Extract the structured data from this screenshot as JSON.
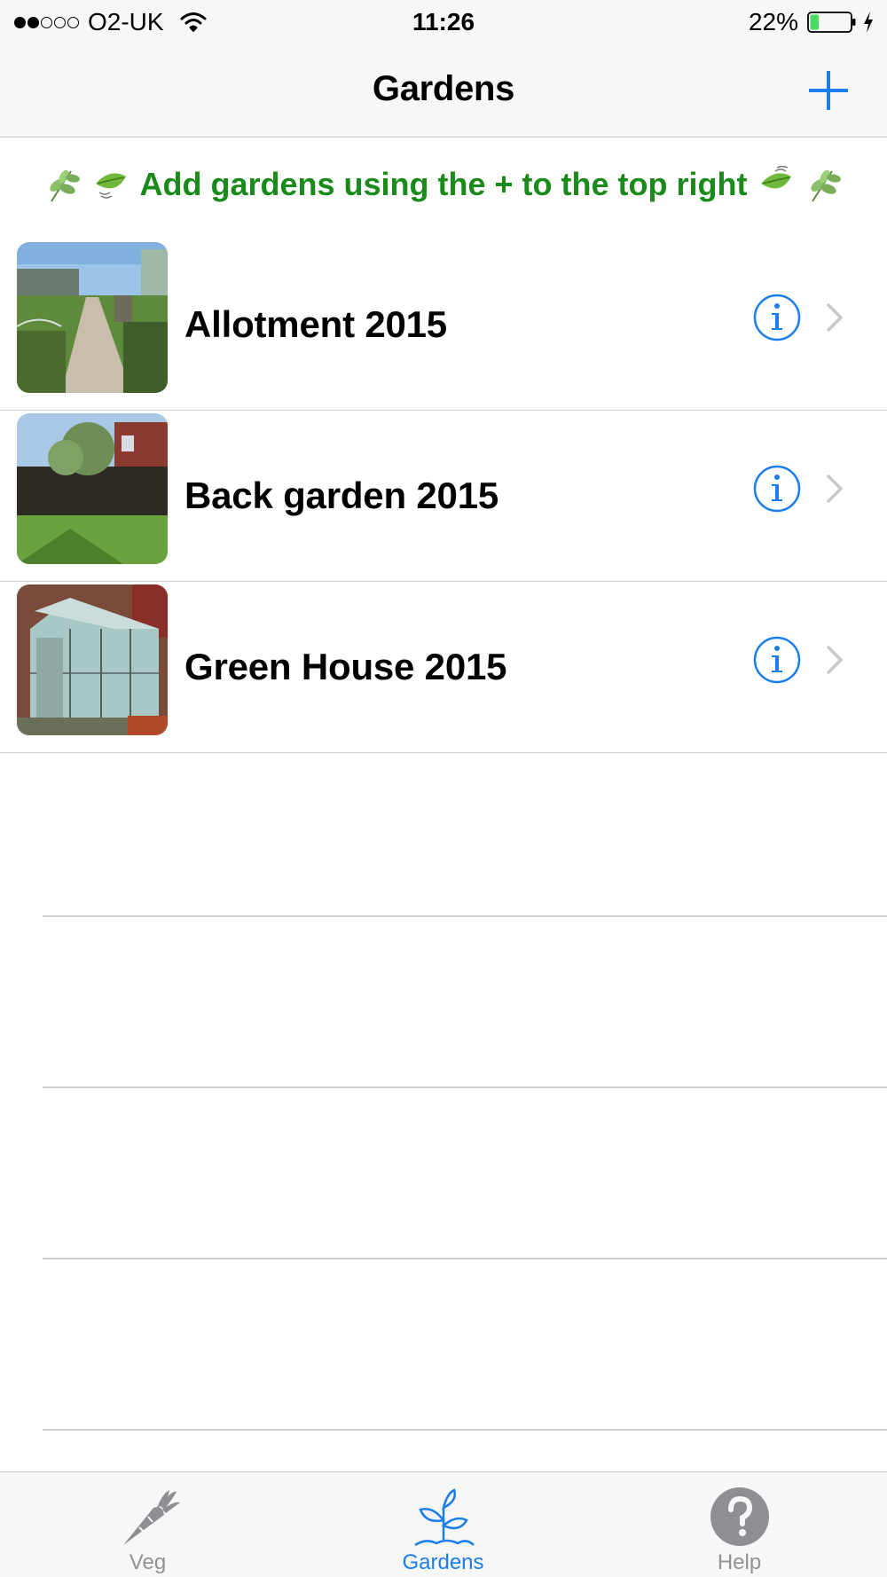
{
  "status_bar": {
    "carrier": "O2-UK",
    "signal_bars_filled": 2,
    "signal_bars_total": 5,
    "time": "11:26",
    "battery_percent": "22%",
    "battery_level": 0.22,
    "charging_icon": "bolt-icon"
  },
  "nav": {
    "title": "Gardens",
    "add_icon": "plus-icon"
  },
  "hint": {
    "text": "Add gardens using the + to the top right",
    "icon": "leaf-icon"
  },
  "gardens": [
    {
      "name": "Allotment 2015",
      "thumbnail": "allotment-photo"
    },
    {
      "name": "Back garden 2015",
      "thumbnail": "back-garden-photo"
    },
    {
      "name": "Green House 2015",
      "thumbnail": "greenhouse-photo"
    }
  ],
  "tabs": [
    {
      "label": "Veg",
      "icon": "carrot-icon",
      "active": false
    },
    {
      "label": "Gardens",
      "icon": "seedling-icon",
      "active": true
    },
    {
      "label": "Help",
      "icon": "help-icon",
      "active": false
    }
  ],
  "colors": {
    "accent": "#1a7df0",
    "hint_green": "#1a8a1a",
    "bar_background": "#f7f7f7",
    "separator": "#d0d0d4",
    "inactive_tab": "#929292",
    "battery_fill": "#4cd964"
  }
}
